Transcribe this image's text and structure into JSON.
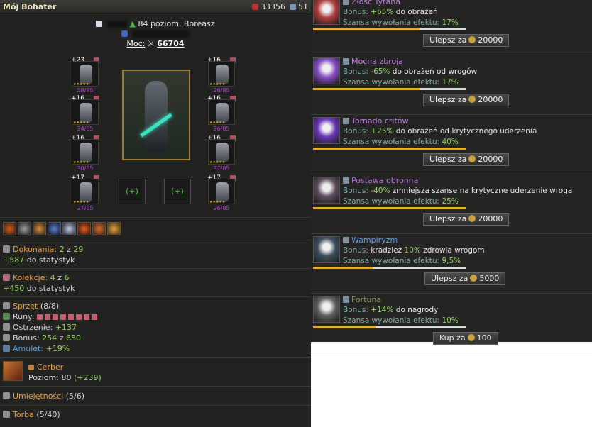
{
  "header": {
    "title": "Mój Bohater",
    "gold": "33356",
    "gems": "51"
  },
  "hero": {
    "level_text": "84 poziom, Boreasz",
    "power_label": "Moc:",
    "power_value": "66704"
  },
  "gear": [
    {
      "plus": "+23",
      "durability": "58/85"
    },
    {
      "plus": "+16",
      "durability": "26/85"
    },
    {
      "plus": "+16",
      "durability": "24/85"
    },
    {
      "plus": "+16",
      "durability": "26/85"
    },
    {
      "plus": "+16",
      "durability": "30/85"
    },
    {
      "plus": "+16",
      "durability": "37/85"
    },
    {
      "plus": "+17",
      "durability": "27/85"
    },
    {
      "plus": "+17",
      "durability": "26/85"
    }
  ],
  "empty_slot_label": "(+)",
  "achievements": {
    "label": "Dokonania:",
    "value": "2",
    "of": "z",
    "total": "29",
    "bonus": "+587",
    "bonus_suffix": "do statystyk"
  },
  "collections": {
    "label": "Kolekcje:",
    "value": "4",
    "of": "z",
    "total": "6",
    "bonus": "+450",
    "bonus_suffix": "do statystyk"
  },
  "equipment": {
    "label": "Sprzęt",
    "count": "(8/8)",
    "runes_label": "Runy:",
    "sharpening_label": "Ostrzenie:",
    "sharpening_value": "+137",
    "bonus_label": "Bonus:",
    "bonus_value": "254",
    "bonus_of": "z",
    "bonus_total": "680",
    "amulet_label": "Amulet:",
    "amulet_value": "+19%"
  },
  "pet": {
    "name": "Cerber",
    "level_label": "Poziom: 80",
    "level_bonus": "(+239)"
  },
  "skills_section": {
    "label": "Umiejętności",
    "count": "(5/6)"
  },
  "bag_section": {
    "label": "Torba",
    "count": "(5/40)"
  },
  "skills": [
    {
      "name": "Złość Tytana",
      "bonus_label": "Bonus:",
      "bonus_value": "+65%",
      "bonus_text": "do obrażeń",
      "chance_label": "Szansa wywołania efektu:",
      "chance_value": "17%",
      "chance_fraction": 0.17,
      "button": "Ulepsz za",
      "cost": "20000",
      "icon": "fist-icon",
      "color": "#b04040"
    },
    {
      "name": "Mocna zbroja",
      "bonus_label": "Bonus:",
      "bonus_value": "-65%",
      "bonus_text": "do obrażeń od wrogów",
      "chance_label": "Szansa wywołania efektu:",
      "chance_value": "17%",
      "chance_fraction": 0.17,
      "button": "Ulepsz za",
      "cost": "20000",
      "icon": "shield-icon",
      "color": "#8a50c8"
    },
    {
      "name": "Tornado critów",
      "bonus_label": "Bonus:",
      "bonus_value": "+25%",
      "bonus_text": "do obrażeń od krytycznego uderzenia",
      "chance_label": "Szansa wywołania efektu:",
      "chance_value": "40%",
      "chance_fraction": 0.4,
      "button": "Ulepsz za",
      "cost": "20000",
      "icon": "tornado-icon",
      "color": "#6a3ab8"
    },
    {
      "name": "Postawa obronna",
      "bonus_label": "Bonus:",
      "bonus_value": "-40%",
      "bonus_text": "zmniejsza szanse na krytyczne uderzenie wroga",
      "chance_label": "Szansa wywołania efektu:",
      "chance_value": "25%",
      "chance_fraction": 0.25,
      "button": "Ulepsz za",
      "cost": "20000",
      "icon": "stance-icon",
      "color": "#605060"
    },
    {
      "name": "Wampiryzm",
      "bonus_label": "Bonus:",
      "bonus_value": "kradzież",
      "bonus_pct": "10%",
      "bonus_text": "zdrowia wrogom",
      "chance_label": "Szansa wywołania efektu:",
      "chance_value": "9,5%",
      "chance_fraction": 0.095,
      "button": "Ulepsz za",
      "cost": "5000",
      "icon": "vampire-icon",
      "color": "#405060"
    },
    {
      "name": "Fortuna",
      "bonus_label": "Bonus:",
      "bonus_value": "+14%",
      "bonus_text": "do nagrody",
      "chance_label": "Szansa wywołania efektu:",
      "chance_value": "10%",
      "chance_fraction": 0.1,
      "button": "Kup za",
      "cost": "100",
      "icon": "dice-icon",
      "color": "#606060"
    }
  ]
}
